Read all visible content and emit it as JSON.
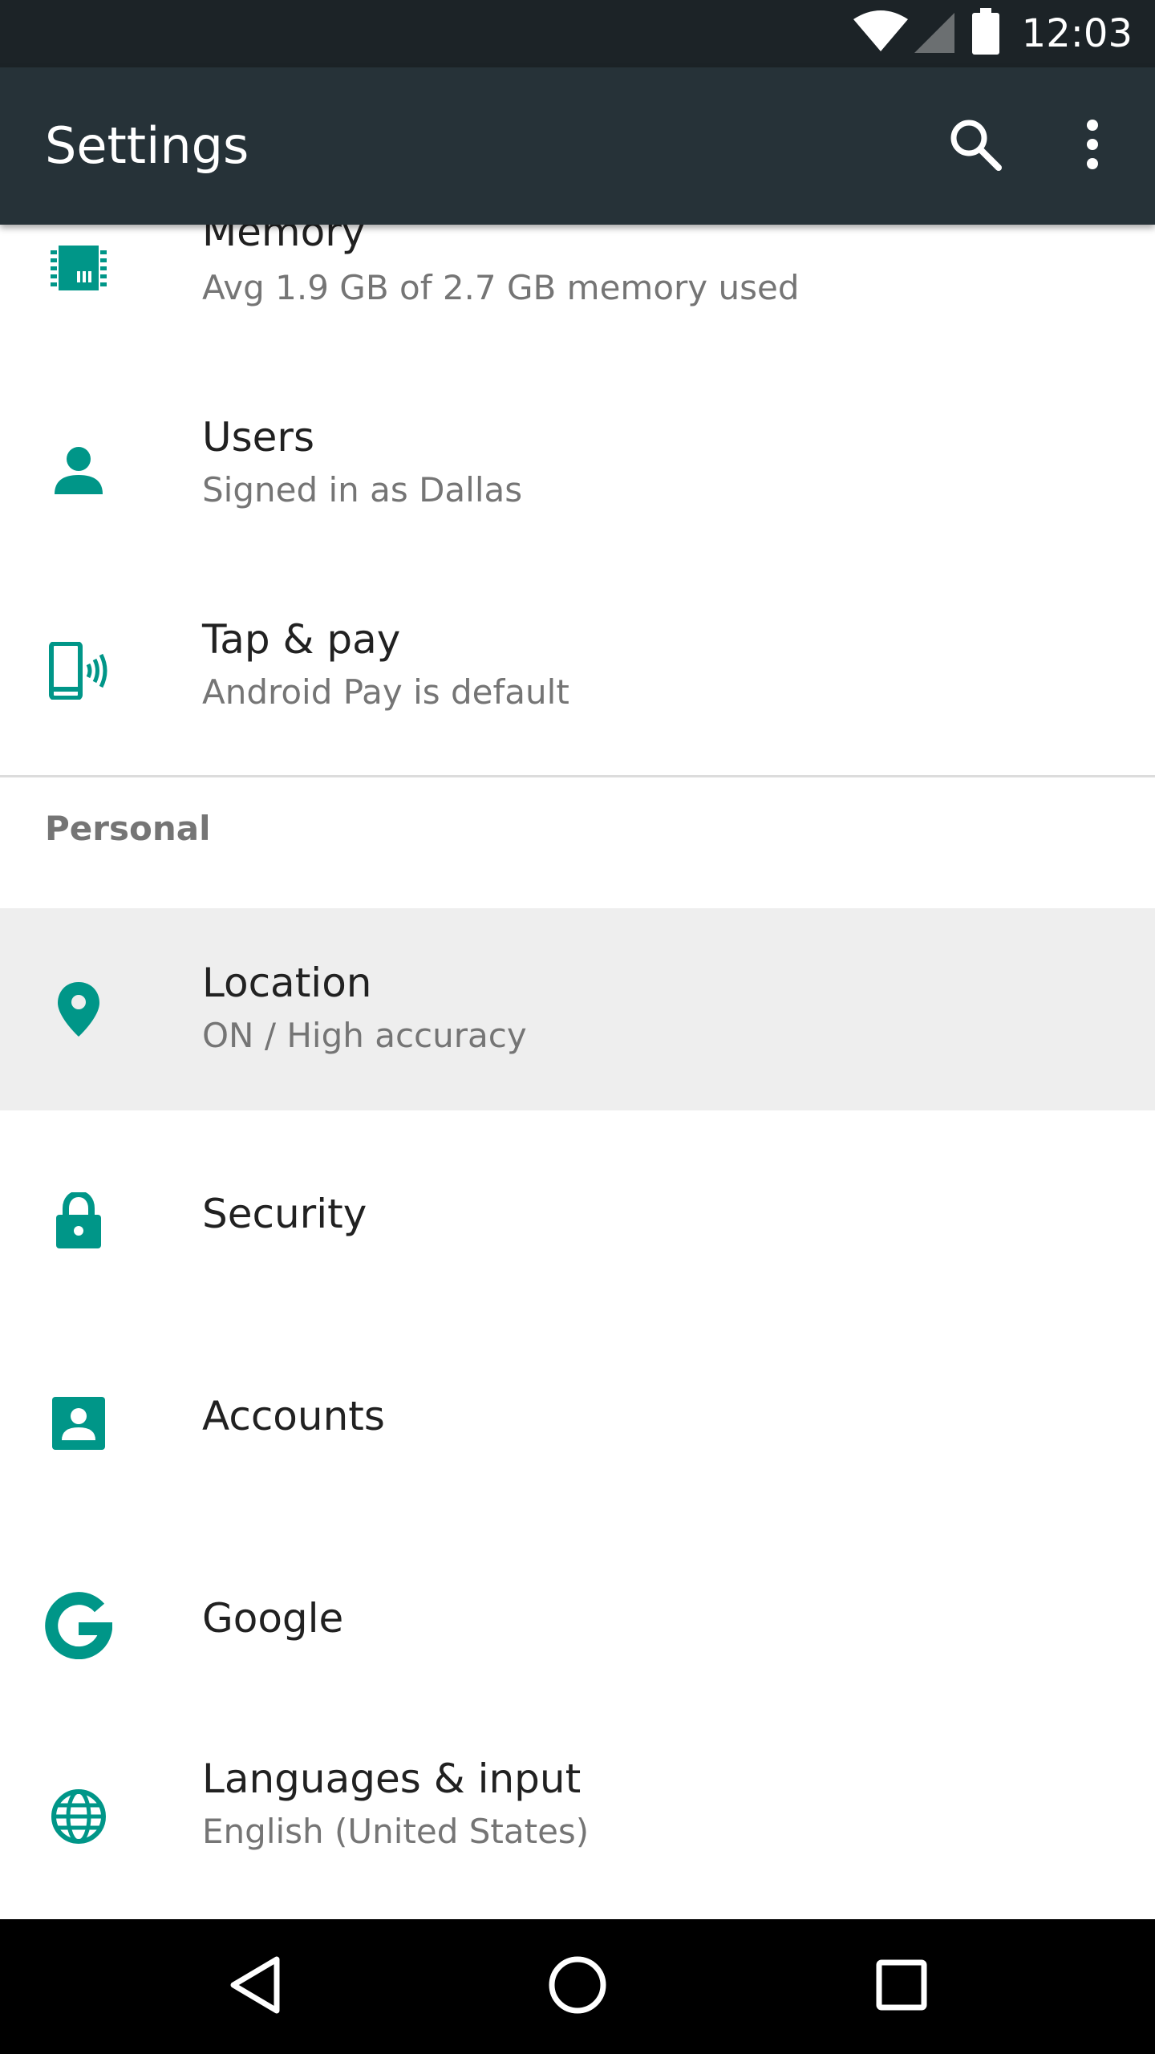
{
  "status_bar": {
    "time": "12:03"
  },
  "app_bar": {
    "title": "Settings",
    "actions": [
      {
        "icon": "search-icon"
      },
      {
        "icon": "more-vert-icon"
      }
    ]
  },
  "colors": {
    "accent": "#009688",
    "app_bar": "#263238",
    "status_bar": "#1c2327",
    "selected_row": "#eeeeee",
    "primary_text": "#212121",
    "secondary_text": "#757575"
  },
  "device_items": [
    {
      "icon": "memory-icon",
      "title": "Memory",
      "summary": "Avg 1.9 GB of 2.7 GB memory used"
    },
    {
      "icon": "person-icon",
      "title": "Users",
      "summary": "Signed in as Dallas"
    },
    {
      "icon": "tap-and-pay-icon",
      "title": "Tap & pay",
      "summary": "Android Pay is default"
    }
  ],
  "personal": {
    "header": "Personal",
    "items": [
      {
        "icon": "location-pin-icon",
        "title": "Location",
        "summary": "ON / High accuracy"
      },
      {
        "icon": "lock-icon",
        "title": "Security"
      },
      {
        "icon": "account-box-icon",
        "title": "Accounts"
      },
      {
        "icon": "google-icon",
        "title": "Google"
      },
      {
        "icon": "globe-icon",
        "title": "Languages & input",
        "summary": "English (United States)"
      }
    ]
  },
  "nav_bar": {
    "buttons": [
      {
        "icon": "back-icon"
      },
      {
        "icon": "home-icon"
      },
      {
        "icon": "recents-icon"
      }
    ]
  }
}
